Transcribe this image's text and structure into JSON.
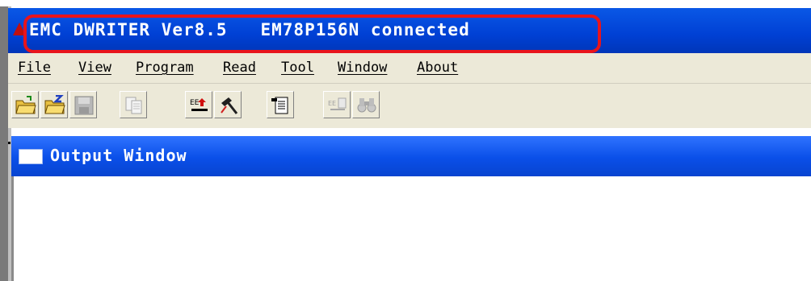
{
  "window": {
    "title": "EMC DWRITER Ver8.5   EM78P156N connected"
  },
  "menu": {
    "items": [
      {
        "label": "File"
      },
      {
        "label": "View"
      },
      {
        "label": "Program"
      },
      {
        "label": "Read"
      },
      {
        "label": "Tool"
      },
      {
        "label": "Window"
      },
      {
        "label": "About"
      }
    ]
  },
  "toolbar": {
    "buttons": [
      {
        "icon": "open-folder-icon"
      },
      {
        "icon": "open-recent-folder-icon"
      },
      {
        "icon": "save-icon"
      },
      {
        "icon": "copy-icon"
      },
      {
        "icon": "ee-write-icon"
      },
      {
        "icon": "hammer-icon"
      },
      {
        "icon": "document-icon"
      },
      {
        "icon": "ee-compare-icon"
      },
      {
        "icon": "binoculars-icon"
      }
    ]
  },
  "output_window": {
    "title": "Output Window"
  },
  "colors": {
    "title_bar": "#0040d4",
    "highlight": "#e8141c",
    "menu_bg": "#ece9d8"
  }
}
